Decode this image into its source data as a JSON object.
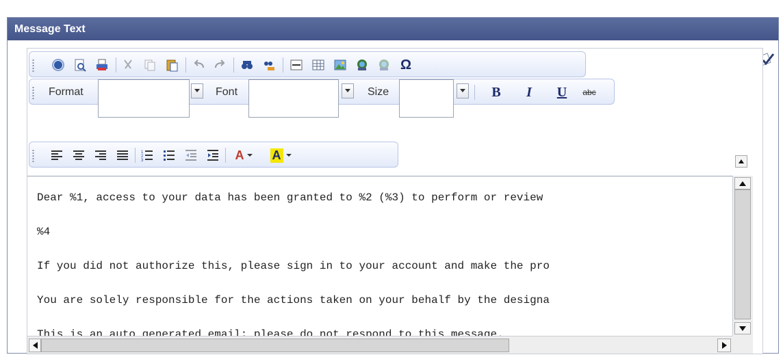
{
  "header": {
    "title": "Message Text"
  },
  "toolbar": {
    "row1": [
      "source-icon",
      "preview-icon",
      "print-icon",
      "cut-icon",
      "copy-icon",
      "paste-icon",
      "undo-icon",
      "redo-icon",
      "find-icon",
      "replace-icon",
      "horizontal-rule-icon",
      "table-icon",
      "image-icon",
      "link-icon",
      "unlink-icon",
      "special-char-icon"
    ],
    "format_label": "Format",
    "format_value": "",
    "font_label": "Font",
    "font_value": "",
    "size_label": "Size",
    "size_value": "",
    "bold": "B",
    "italic": "I",
    "underline": "U",
    "strike": "abc",
    "special_char": "Ω",
    "text_color_letter": "A",
    "bg_color_letter": "A",
    "row3": [
      "align-left-icon",
      "align-center-icon",
      "align-right-icon",
      "justify-icon",
      "numbered-list-icon",
      "bullet-list-icon",
      "outdent-icon",
      "indent-icon",
      "text-color-icon",
      "background-color-icon"
    ]
  },
  "message": {
    "lines": [
      "Dear %1, access to your data has been granted to %2 (%3) to perform or review",
      "%4",
      "If you did not authorize this, please sign in to your account and make the pro",
      "You are solely responsible for the actions taken on your behalf by the designa",
      "This is an auto generated email; please do not respond to this message."
    ]
  },
  "colors": {
    "header_bg": "#4e5f93",
    "toolbar_border": "#b9c5e6",
    "text_color_icon": "#c0392b",
    "bg_color_highlight": "#f4e600"
  }
}
